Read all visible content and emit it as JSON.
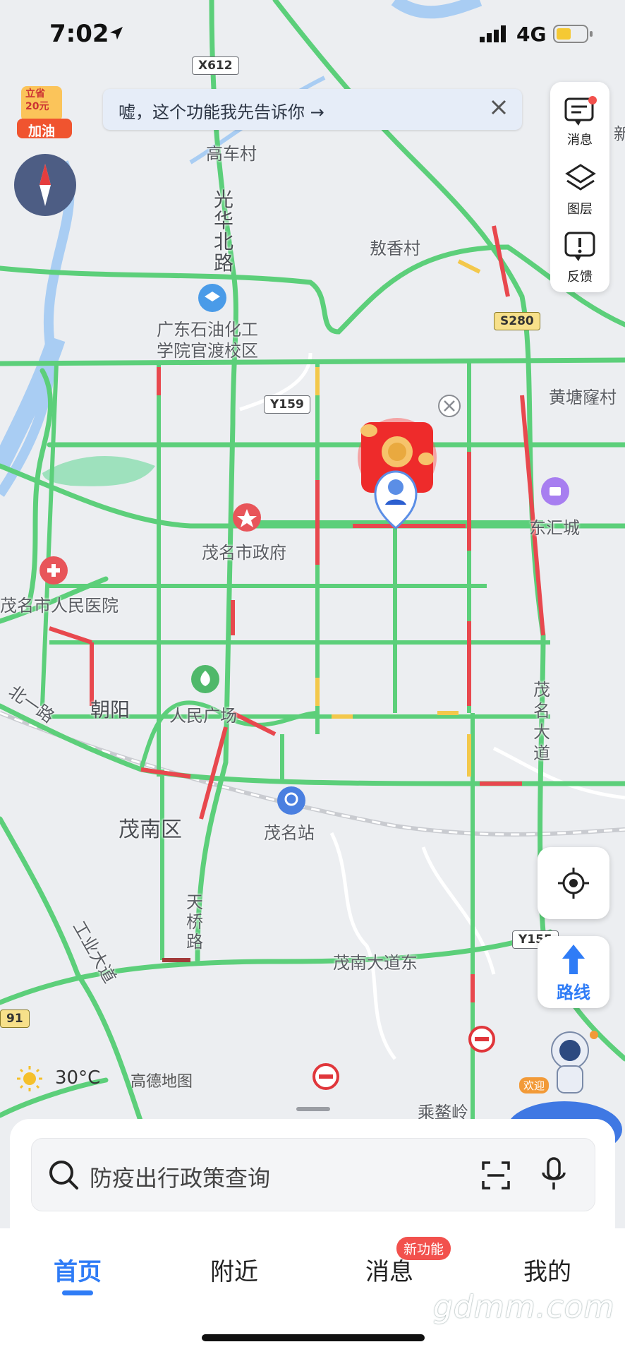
{
  "status_bar": {
    "time": "7:02",
    "network": "4G"
  },
  "notice": {
    "text": "嘘，这个功能我先告诉你 →"
  },
  "promo": {
    "line1": "立省",
    "line2": "20元",
    "line3": "加油"
  },
  "side_panel": {
    "messages": "消息",
    "layers": "图层",
    "feedback": "反馈"
  },
  "route_button": {
    "label": "路线"
  },
  "weather": {
    "temp": "30°C",
    "brand": "高德地图"
  },
  "search": {
    "placeholder": "防疫出行政策查询"
  },
  "tabs": {
    "home": "首页",
    "nearby": "附近",
    "messages": "消息",
    "mine": "我的",
    "new_badge": "新功能"
  },
  "astronaut": {
    "welcome": "欢迎"
  },
  "watermark": "gdmm.com",
  "map": {
    "labels": {
      "x612": "X612",
      "gaoche": "高车村",
      "guanghua": "光华北路",
      "aoxiang": "敖香村",
      "s280": "S280",
      "school": "广东石油化工\n学院官渡校区",
      "huangtang": "黄塘窿村",
      "y159": "Y159",
      "donghui": "东汇城",
      "government": "茂名市政府",
      "hospital": "茂名市人民医院",
      "chaoyang": "朝阳",
      "square": "人民广场",
      "maomingdadao": "茂名大道",
      "beiyilu": "北一路",
      "maonan": "茂南区",
      "station": "茂名站",
      "tianqiao": "天桥路",
      "maonandadao": "茂南大道东",
      "y155": "Y155",
      "gongye": "工业大道",
      "road91": "91",
      "chengao": "乘鳌岭",
      "edge": "新"
    }
  },
  "colors": {
    "accent": "#2f7cf6",
    "traffic_green": "#5ccf7a",
    "traffic_red": "#e8484e",
    "traffic_yellow": "#f3c84b",
    "water": "#a9cdf3",
    "park": "#9ee1bd"
  }
}
